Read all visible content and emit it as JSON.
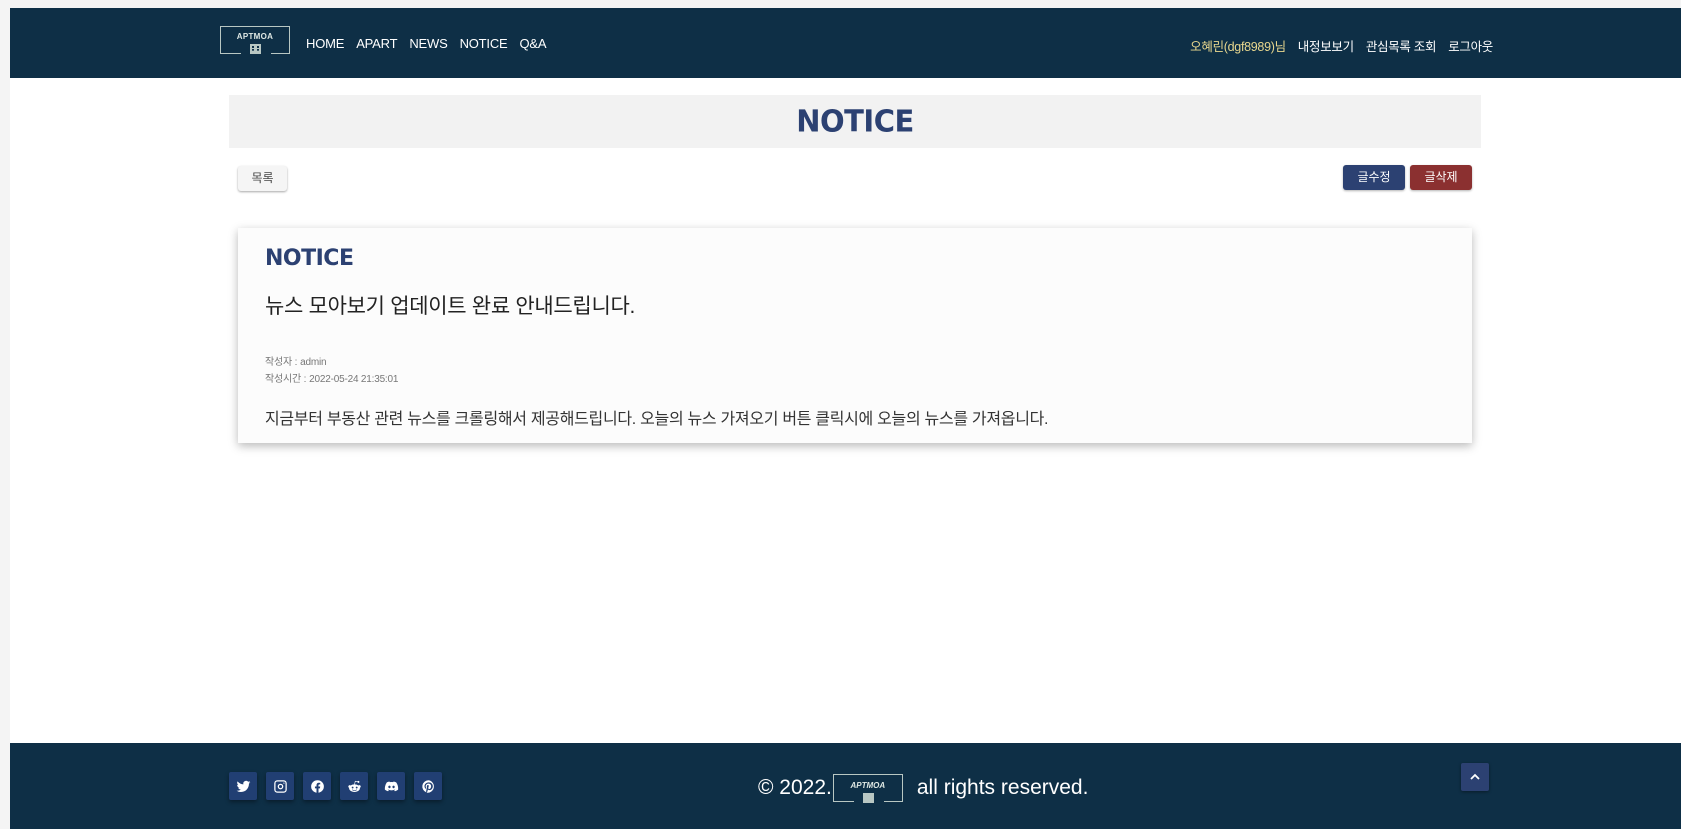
{
  "header": {
    "logo_text": "APTMOA",
    "nav": [
      "HOME",
      "APART",
      "NEWS",
      "NOTICE",
      "Q&A"
    ],
    "user": {
      "name": "오혜린(dgf8989)님",
      "my_info": "내정보보기",
      "favorites": "관심목록 조회",
      "logout": "로그아웃"
    }
  },
  "page": {
    "title": "NOTICE"
  },
  "actions": {
    "list": "목록",
    "edit": "글수정",
    "delete": "글삭제"
  },
  "post": {
    "label": "NOTICE",
    "title": "뉴스 모아보기 업데이트 완료 안내드립니다.",
    "author_label": "작성자 :",
    "author": "admin",
    "time_label": "작성시간 :",
    "time": "2022-05-24 21:35:01",
    "body": "지금부터 부동산 관련 뉴스를 크롤링해서 제공해드립니다. 오늘의 뉴스 가져오기 버튼 클릭시에 오늘의 뉴스를 가져옵니다."
  },
  "footer": {
    "copyright_prefix": "© 2022.",
    "logo_text": "APTMOA",
    "copyright_suffix": "all rights reserved.",
    "socials": [
      "twitter-icon",
      "instagram-icon",
      "facebook-icon",
      "reddit-icon",
      "discord-icon",
      "pinterest-icon"
    ]
  },
  "colors": {
    "navy": "#0e2f46",
    "accent": "#2c4172",
    "danger": "#8b3030",
    "user_name": "#e8d78e"
  }
}
